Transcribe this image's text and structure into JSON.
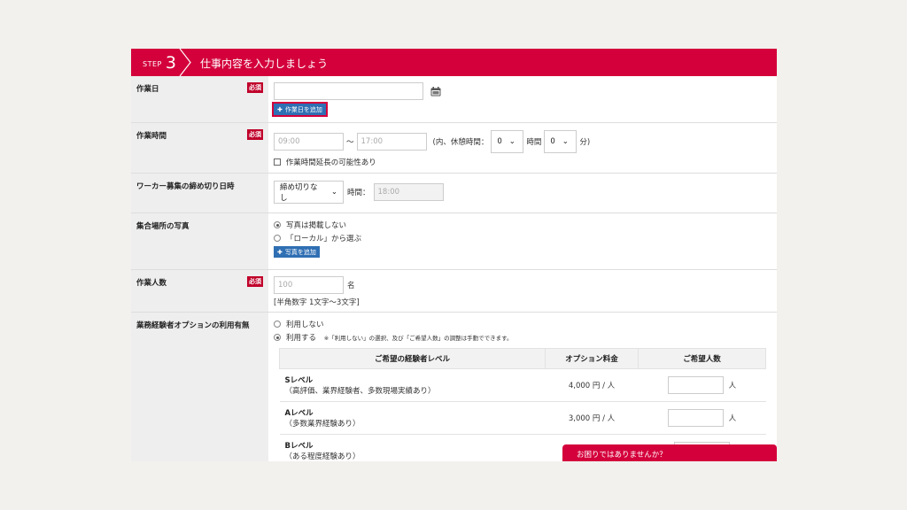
{
  "header": {
    "step_word": "STEP",
    "step_num": "3",
    "title": "仕事内容を入力しましょう"
  },
  "required_badge": "必須",
  "work_date": {
    "label": "作業日",
    "add_button": "作業日を追加"
  },
  "work_time": {
    "label": "作業時間",
    "start_placeholder": "09:00",
    "tilde": "〜",
    "end_placeholder": "17:00",
    "break_prefix": "(内、休憩時間：",
    "break_hours": "0",
    "hours_unit": "時間",
    "break_minutes": "0",
    "minutes_unit": "分)",
    "extension_label": "作業時間延長の可能性あり"
  },
  "deadline": {
    "label": "ワーカー募集の締め切り日時",
    "select_value": "締め切りなし",
    "time_label": "時間：",
    "time_placeholder": "18:00"
  },
  "photo": {
    "label": "集合場所の写真",
    "option_none": "写真は掲載しない",
    "option_local": "「ローカル」から選ぶ",
    "add_button": "写真を追加"
  },
  "headcount": {
    "label": "作業人数",
    "placeholder": "100",
    "unit": "名",
    "hint": "[半角数字 1文字〜3文字]"
  },
  "experienced": {
    "label": "業務経験者オプションの利用有無",
    "option_no": "利用しない",
    "option_yes": "利用する",
    "note": "※「利用しない」の選択、及び「ご希望人数」の調整は手動でできます。",
    "table_headers": [
      "ご希望の経験者レベル",
      "オプション料金",
      "ご希望人数"
    ],
    "levels": [
      {
        "name": "Sレベル",
        "desc": "（高評価、業界経験者、多数現場実績あり）",
        "price": "4,000 円 / 人",
        "unit": "人"
      },
      {
        "name": "Aレベル",
        "desc": "（多数業界経験あり）",
        "price": "3,000 円 / 人",
        "unit": "人"
      },
      {
        "name": "Bレベル",
        "desc": "（ある程度経験あり）",
        "price": "",
        "unit": ""
      }
    ]
  },
  "help_bar": "お困りではありませんか？"
}
